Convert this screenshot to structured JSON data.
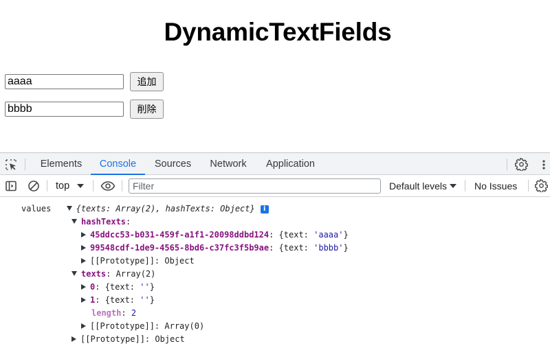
{
  "page": {
    "title": "DynamicTextFields",
    "fields": [
      {
        "value": "aaaa",
        "button_label": "追加"
      },
      {
        "value": "bbbb",
        "button_label": "削除"
      }
    ]
  },
  "devtools": {
    "tabs": [
      "Elements",
      "Console",
      "Sources",
      "Network",
      "Application"
    ],
    "active_tab": "Console",
    "accent_color": "#1a73e8",
    "toolbar": {
      "context": "top",
      "filter_placeholder": "Filter",
      "levels_label": "Default levels",
      "issues_label": "No Issues"
    },
    "console": {
      "label": "values",
      "summary": {
        "open": "{",
        "texts_key": "texts",
        "texts_type": "Array(2)",
        "hash_key": "hashTexts",
        "hash_type": "Object",
        "close": "}",
        "sep": ": ",
        "comma": ", "
      },
      "info_icon": "i",
      "hashTexts": {
        "key": "hashTexts",
        "entries": [
          {
            "key": "45ddcc53-b031-459f-a1f1-20098ddbd124",
            "preview_open": "{text: ",
            "value": "'aaaa'",
            "preview_close": "}"
          },
          {
            "key": "99548cdf-1de9-4565-8bd6-c37fc3f5b9ae",
            "preview_open": "{text: ",
            "value": "'bbbb'",
            "preview_close": "}"
          }
        ],
        "prototype": "[[Prototype]]",
        "prototype_value": "Object"
      },
      "texts": {
        "key": "texts",
        "type": "Array(2)",
        "items": [
          {
            "key": "0",
            "preview_open": "{text: ",
            "value": "''",
            "preview_close": "}"
          },
          {
            "key": "1",
            "preview_open": "{text: ",
            "value": "''",
            "preview_close": "}"
          }
        ],
        "length_key": "length",
        "length_value": "2",
        "prototype": "[[Prototype]]",
        "prototype_value": "Array(0)"
      },
      "root_prototype": "[[Prototype]]",
      "root_prototype_value": "Object"
    }
  }
}
